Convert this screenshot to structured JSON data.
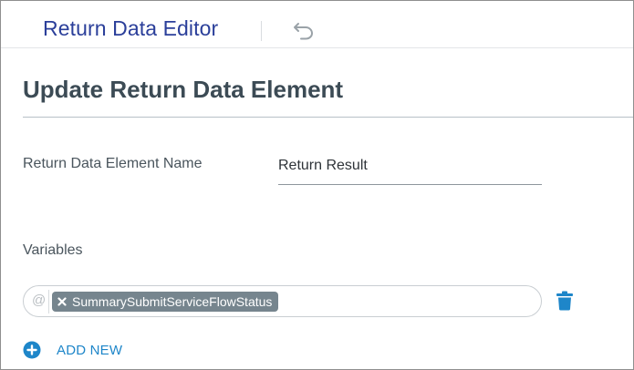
{
  "header": {
    "title": "Return Data Editor",
    "undo_icon": "undo-icon"
  },
  "section": {
    "title": "Update Return Data Element"
  },
  "name_field": {
    "label": "Return Data Element Name",
    "value": "Return Result"
  },
  "variables": {
    "label": "Variables",
    "prefix_symbol": "@",
    "chips": [
      {
        "label": "SummarySubmitServiceFlowStatus",
        "remove_icon": "close-icon"
      }
    ],
    "delete_icon": "trash-icon"
  },
  "add_new": {
    "label": "ADD NEW",
    "icon": "plus-circle-icon"
  },
  "colors": {
    "header_title": "#2b3f9a",
    "section_title": "#3c4b55",
    "chip_bg": "#76858e",
    "accent": "#1e86c9"
  }
}
